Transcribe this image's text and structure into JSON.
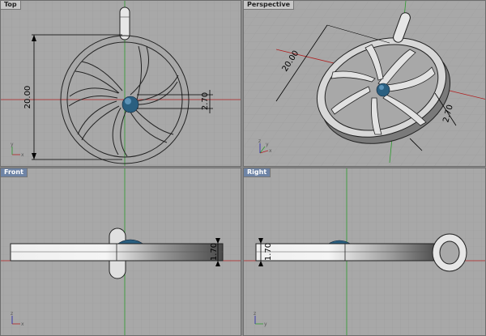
{
  "viewports": {
    "top": {
      "title": "Top",
      "dim_diameter": "20.00",
      "dim_offset": "2.70",
      "axis_x": "x",
      "axis_y": "y"
    },
    "perspective": {
      "title": "Perspective",
      "dim_diameter": "20.00",
      "dim_offset": "2.70",
      "axis_x": "x",
      "axis_y": "y",
      "axis_z": "z"
    },
    "front": {
      "title": "Front",
      "dim_thickness": "1.70",
      "axis_x": "x",
      "axis_z": "z"
    },
    "right": {
      "title": "Right",
      "dim_thickness": "1.70",
      "axis_y": "y",
      "axis_z": "z"
    }
  },
  "colors": {
    "viewport_bg": "#a8a8a8",
    "grid_minor": "#9d9d9d",
    "grid_major": "#8f8f8f",
    "axis_x": "#b02020",
    "axis_y": "#2a9a2a",
    "gem": "#2a5f80",
    "active_title_bg": "#6e84a6"
  }
}
